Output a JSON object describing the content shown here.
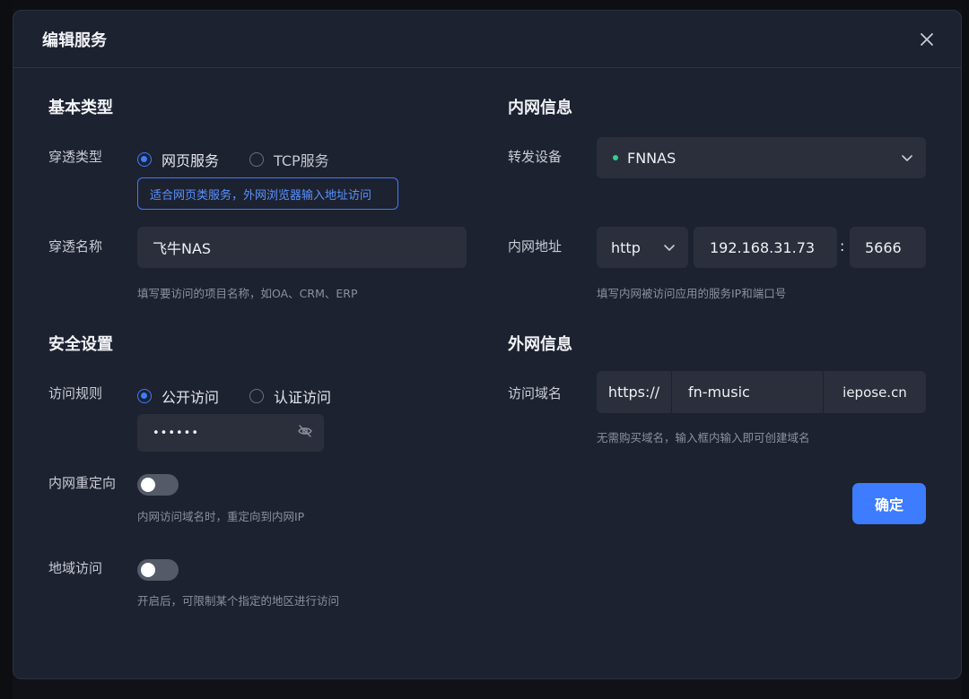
{
  "dialog": {
    "title": "编辑服务"
  },
  "basic": {
    "section_title": "基本类型",
    "type_label": "穿透类型",
    "type_options": [
      "网页服务",
      "TCP服务"
    ],
    "type_selected": "网页服务",
    "type_info": "适合网页类服务，外网浏览器输入地址访问",
    "name_label": "穿透名称",
    "name_value": "飞牛NAS",
    "name_hint": "填写要访问的项目名称，如OA、CRM、ERP"
  },
  "security": {
    "section_title": "安全设置",
    "rule_label": "访问规则",
    "rule_options": [
      "公开访问",
      "认证访问"
    ],
    "rule_selected": "公开访问",
    "password_value": "••••••",
    "redirect_label": "内网重定向",
    "redirect_enabled": false,
    "redirect_hint": "内网访问域名时，重定向到内网IP",
    "region_label": "地域访问",
    "region_enabled": false,
    "region_hint": "开启后，可限制某个指定的地区进行访问"
  },
  "intranet": {
    "section_title": "内网信息",
    "device_label": "转发设备",
    "device_value": "FNNAS",
    "address_label": "内网地址",
    "protocol_value": "http",
    "ip_value": "192.168.31.73",
    "colon": ":",
    "port_value": "5666",
    "address_hint": "填写内网被访问应用的服务IP和端口号"
  },
  "extranet": {
    "section_title": "外网信息",
    "domain_label": "访问域名",
    "domain_prefix": "https://",
    "domain_value": "fn-music",
    "domain_suffix": "iepose.cn",
    "domain_hint": "无需购买域名，输入框内输入即可创建域名"
  },
  "actions": {
    "confirm_label": "确定"
  },
  "colors": {
    "accent": "#3d7bff",
    "online": "#2dd28d",
    "panel": "#1d2230",
    "field": "#2a2f3b"
  },
  "icons": [
    "close-icon",
    "chevron-down-icon",
    "eye-off-icon",
    "status-dot-icon"
  ]
}
